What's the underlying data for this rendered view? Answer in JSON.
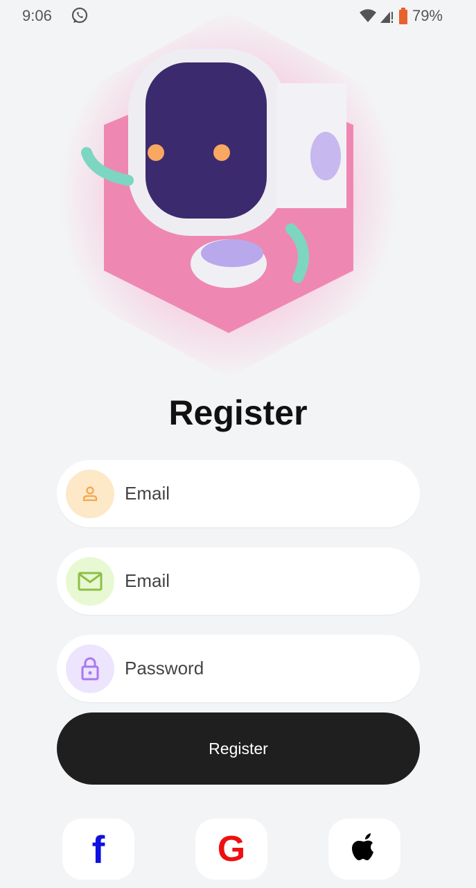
{
  "status_bar": {
    "time": "9:06",
    "battery": "79%"
  },
  "title": "Register",
  "fields": [
    {
      "placeholder": "Email",
      "icon": "user-icon",
      "bg": "#fde8c8",
      "color": "#f4a54c"
    },
    {
      "placeholder": "Email",
      "icon": "mail-icon",
      "bg": "#e8f8d2",
      "color": "#8cbf45"
    },
    {
      "placeholder": "Password",
      "icon": "lock-icon",
      "bg": "#ede4fd",
      "color": "#a679f0"
    }
  ],
  "register_button": "Register",
  "social": [
    {
      "icon": "facebook-icon",
      "label": "f",
      "color": "#1010e0"
    },
    {
      "icon": "google-icon",
      "label": "G",
      "color": "#ee1010"
    },
    {
      "icon": "apple-icon",
      "color": "#000"
    }
  ]
}
